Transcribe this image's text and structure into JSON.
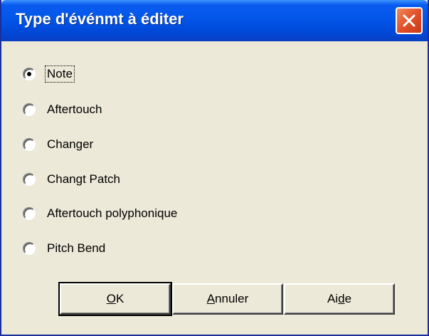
{
  "dialog": {
    "title": "Type d'événmt à éditer",
    "close_label": "×"
  },
  "options": [
    {
      "label": "Note",
      "selected": true
    },
    {
      "label": "Aftertouch",
      "selected": false
    },
    {
      "label": "Changer",
      "selected": false
    },
    {
      "label": "Changt Patch",
      "selected": false
    },
    {
      "label": "Aftertouch polyphonique",
      "selected": false
    },
    {
      "label": "Pitch Bend",
      "selected": false
    }
  ],
  "buttons": {
    "ok": {
      "pre": "",
      "mnemonic": "O",
      "post": "K"
    },
    "cancel": {
      "pre": "",
      "mnemonic": "A",
      "post": "nnuler"
    },
    "help": {
      "pre": "Ai",
      "mnemonic": "d",
      "post": "e"
    }
  },
  "colors": {
    "title_bar": "#0256e8",
    "close_button": "#e2512a",
    "dialog_background": "#ece9d8"
  }
}
